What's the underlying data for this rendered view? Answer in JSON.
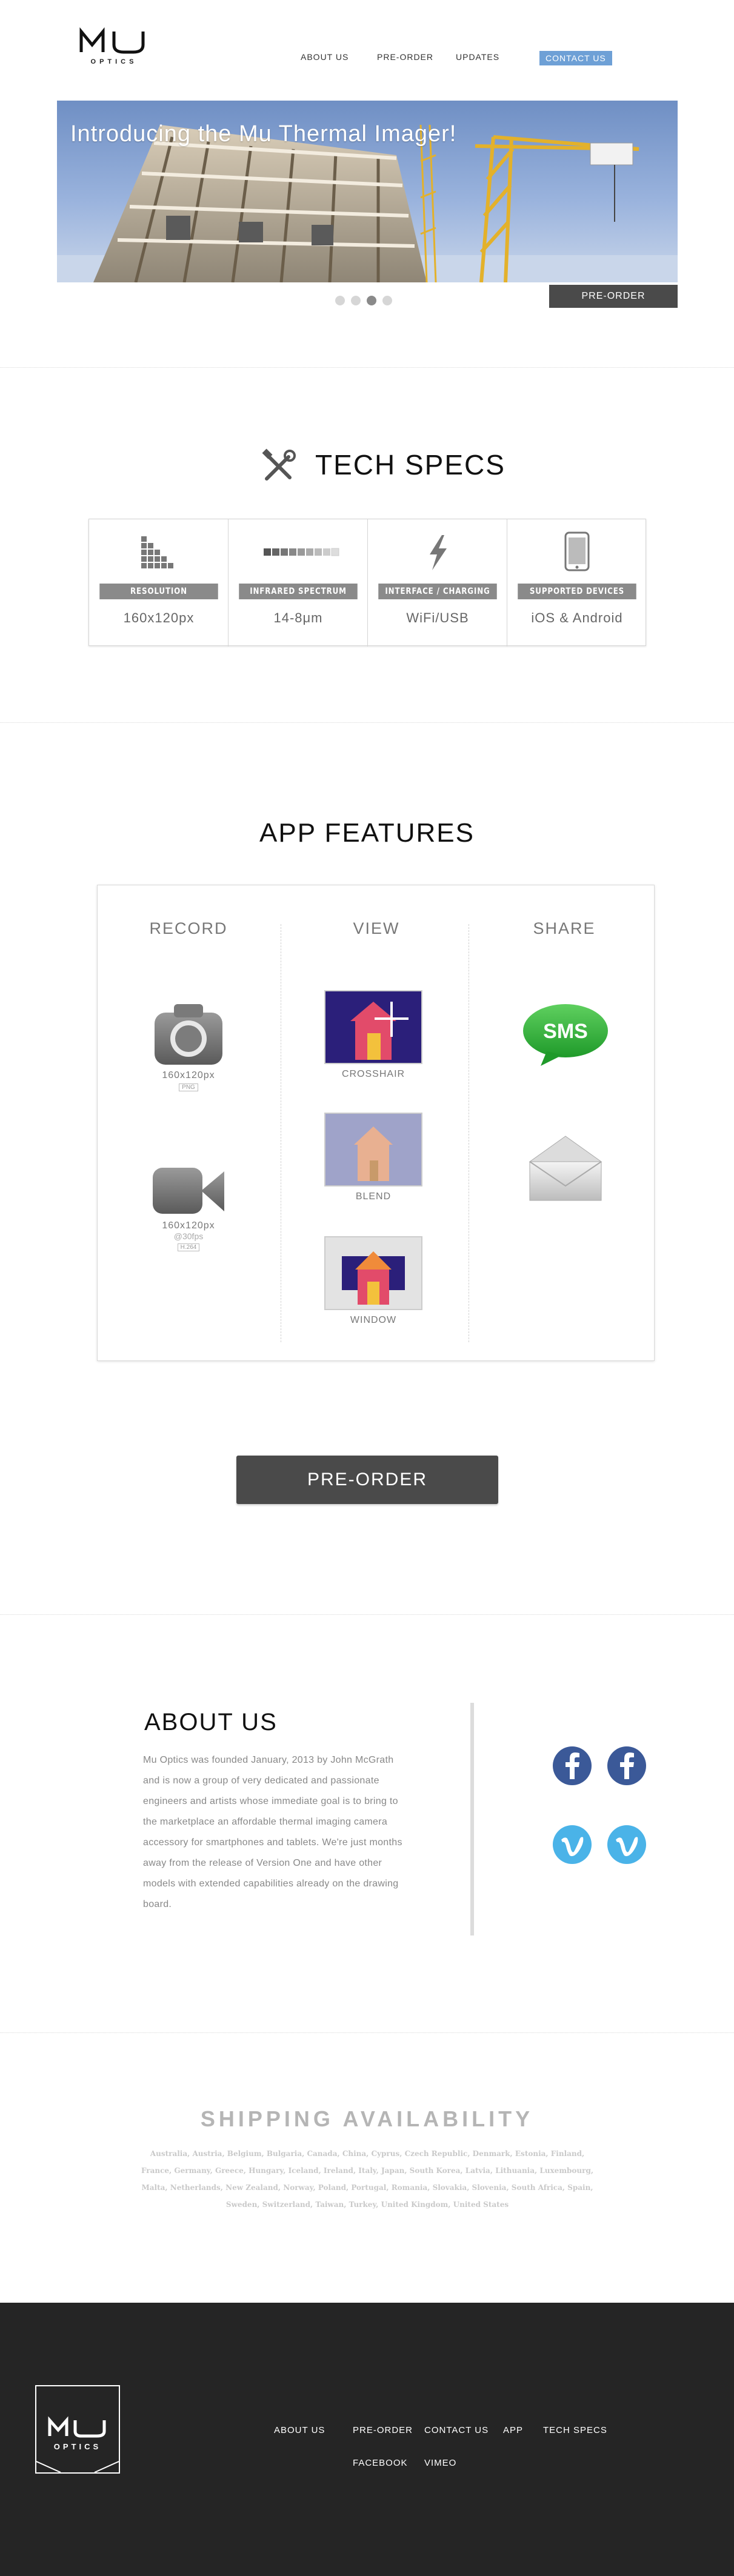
{
  "header": {
    "logo_text": "Mu",
    "logo_sub": "OPTICS",
    "nav": [
      "ABOUT US",
      "PRE-ORDER",
      "UPDATES"
    ],
    "contact_label": "CONTACT US"
  },
  "hero": {
    "title": "Introducing the Mu Thermal Imager!",
    "preorder_label": "PRE-ORDER",
    "slides": 4,
    "active_slide": 3
  },
  "tech_specs": {
    "title": "TECH SPECS",
    "columns": [
      {
        "label": "RESOLUTION",
        "value": "160x120px",
        "icon": "resolution-icon"
      },
      {
        "label": "INFRARED SPECTRUM",
        "value": "14-8μm",
        "icon": "spectrum-icon"
      },
      {
        "label": "INTERFACE / CHARGING",
        "value": "WiFi/USB",
        "icon": "lightning-icon"
      },
      {
        "label": "SUPPORTED DEVICES",
        "value": "iOS & Android",
        "icon": "phone-icon"
      }
    ]
  },
  "app_features": {
    "title": "APP FEATURES",
    "record": {
      "title": "RECORD",
      "photo_caption": "160x120px",
      "photo_badge": "PNG",
      "video_caption": "160x120px",
      "video_sub": "@30fps",
      "video_badge": "H.264"
    },
    "view": {
      "title": "VIEW",
      "items": [
        "CROSSHAIR",
        "BLEND",
        "WINDOW"
      ]
    },
    "share": {
      "title": "SHARE",
      "sms_label": "SMS"
    }
  },
  "cta": {
    "label": "PRE-ORDER"
  },
  "about": {
    "title": "ABOUT US",
    "text": "Mu Optics was founded January, 2013 by John McGrath and is now a group of very dedicated and passionate engineers and artists whose immediate goal is to bring to the marketplace an affordable thermal imaging camera accessory for smartphones and tablets.  We're just months away from the release of Version One and have other models with extended capabilities already on the drawing board."
  },
  "shipping": {
    "title": "SHIPPING AVAILABILITY",
    "countries": "Australia, Austria, Belgium, Bulgaria, Canada, China, Cyprus, Czech Republic, Denmark, Estonia, Finland, France, Germany, Greece, Hungary, Iceland, Ireland, Italy, Japan, South Korea, Latvia, Lithuania, Luxembourg, Malta, Netherlands, New Zealand, Norway, Poland, Portugal, Romania, Slovakia, Slovenia, South Africa, Spain, Sweden, Switzerland, Taiwan, Turkey, United Kingdom, United States"
  },
  "footer": {
    "logo_text": "Mu",
    "logo_sub": "OPTICS",
    "links_row1": [
      "ABOUT US",
      "PRE-ORDER",
      "CONTACT US",
      "APP",
      "TECH SPECS"
    ],
    "links_row2": [
      "FACEBOOK",
      "VIMEO"
    ]
  },
  "colors": {
    "accent": "#6ea0d6",
    "dark_button": "#4a4a4a",
    "footer_bg": "#252525",
    "facebook": "#3b5998",
    "vimeo": "#4ab3e8"
  }
}
